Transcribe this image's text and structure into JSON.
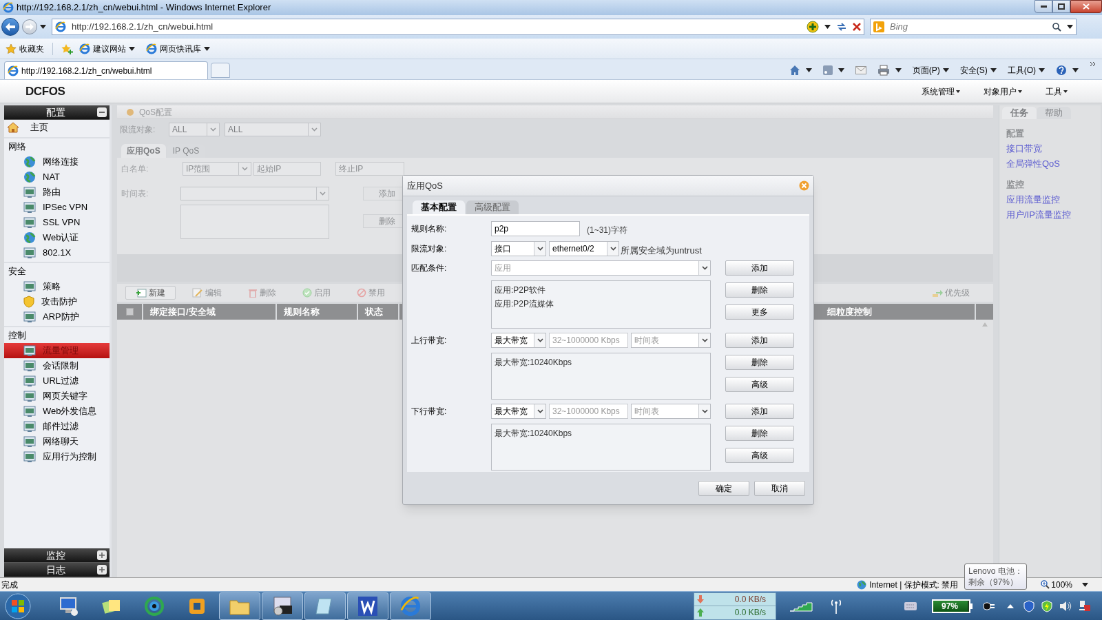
{
  "browser": {
    "title": "http://192.168.2.1/zh_cn/webui.html - Windows Internet Explorer",
    "address": "http://192.168.2.1/zh_cn/webui.html",
    "search_placeholder": "Bing",
    "favorites": [
      "收藏夹",
      "建议网站",
      "网页快讯库"
    ],
    "tab": "http://192.168.2.1/zh_cn/webui.html",
    "commands": [
      "页面(P)",
      "安全(S)",
      "工具(O)"
    ]
  },
  "app": {
    "logo": "DCFOS",
    "menus": [
      "系统管理",
      "对象用户",
      "工具"
    ]
  },
  "sidebar": {
    "panels": [
      {
        "title": "配置",
        "expanded": true,
        "sections": [
          {
            "items": [
              {
                "label": "主页",
                "selected": false
              }
            ]
          },
          {
            "heading": "网络",
            "items": [
              {
                "label": "网络连接",
                "selected": false
              },
              {
                "label": "NAT",
                "selected": false
              },
              {
                "label": "路由",
                "selected": false
              },
              {
                "label": "IPSec VPN",
                "selected": false
              },
              {
                "label": "SSL VPN",
                "selected": false
              },
              {
                "label": "Web认证",
                "selected": false
              },
              {
                "label": "802.1X",
                "selected": false
              }
            ]
          },
          {
            "heading": "安全",
            "items": [
              {
                "label": "策略",
                "selected": false
              },
              {
                "label": "攻击防护",
                "selected": false
              },
              {
                "label": "ARP防护",
                "selected": false
              }
            ]
          },
          {
            "heading": "控制",
            "items": [
              {
                "label": "流量管理",
                "selected": true
              },
              {
                "label": "会话限制",
                "selected": false
              },
              {
                "label": "URL过滤",
                "selected": false
              },
              {
                "label": "网页关键字",
                "selected": false
              },
              {
                "label": "Web外发信息",
                "selected": false
              },
              {
                "label": "邮件过滤",
                "selected": false
              },
              {
                "label": "网络聊天",
                "selected": false
              },
              {
                "label": "应用行为控制",
                "selected": false
              }
            ]
          }
        ]
      },
      {
        "title": "监控",
        "expanded": false
      },
      {
        "title": "日志",
        "expanded": false
      }
    ]
  },
  "qos_page": {
    "title": "QoS配置",
    "target_label": "限流对象:",
    "targets": [
      "ALL",
      "ALL"
    ],
    "tabs": [
      {
        "label": "应用QoS",
        "selected": true
      },
      {
        "label": "IP QoS",
        "selected": false
      }
    ],
    "whitelist_label": "白名单:",
    "whitelist_type": "IP范围",
    "start_ip_placeholder": "起始IP",
    "end_ip_placeholder": "终止IP",
    "schedule_label": "时间表:",
    "buttons": [
      "添加",
      "删除"
    ],
    "toolbar": [
      {
        "label": "新建",
        "disabled": false
      },
      {
        "label": "编辑",
        "disabled": true
      },
      {
        "label": "删除",
        "disabled": true
      },
      {
        "label": "启用",
        "disabled": true
      },
      {
        "label": "禁用",
        "disabled": true
      }
    ],
    "priority": {
      "label": "优先级",
      "disabled": true
    },
    "select_all": {
      "checked": false
    },
    "columns": [
      "绑定接口/安全域",
      "规则名称",
      "状态",
      "细粒度控制"
    ]
  },
  "dialog": {
    "title": "应用QoS",
    "tabs": [
      {
        "label": "基本配置",
        "selected": true
      },
      {
        "label": "高级配置",
        "selected": false
      }
    ],
    "rule_name": {
      "label": "规则名称:",
      "value": "p2p",
      "hint": "(1~31)字符"
    },
    "target": {
      "label": "限流对象:",
      "type": "接口",
      "interface": "ethernet0/2",
      "note": "所属安全域为untrust"
    },
    "match": {
      "label": "匹配条件:",
      "placeholder": "应用",
      "entries": [
        "应用:P2P软件",
        "应用:P2P流媒体"
      ],
      "buttons": [
        "添加",
        "删除",
        "更多"
      ]
    },
    "upstream": {
      "label": "上行带宽:",
      "type": "最大带宽",
      "bandwidth_placeholder": "32~1000000 Kbps",
      "schedule_placeholder": "时间表",
      "entries": [
        "最大带宽:10240Kbps"
      ],
      "buttons": [
        "添加",
        "删除",
        "高级"
      ]
    },
    "downstream": {
      "label": "下行带宽:",
      "type": "最大带宽",
      "bandwidth_placeholder": "32~1000000 Kbps",
      "schedule_placeholder": "时间表",
      "entries": [
        "最大带宽:10240Kbps"
      ],
      "buttons": [
        "添加",
        "删除",
        "高级"
      ]
    },
    "footer_buttons": [
      "确定",
      "取消"
    ]
  },
  "right_panel": {
    "tabs": [
      {
        "label": "任务",
        "selected": true
      },
      {
        "label": "帮助",
        "selected": false
      }
    ],
    "sections": [
      {
        "heading": "配置",
        "links": [
          "接口带宽",
          "全局弹性QoS"
        ]
      },
      {
        "heading": "监控",
        "links": [
          "应用流量监控",
          "用户/IP流量监控"
        ]
      }
    ]
  },
  "status_bar": {
    "text": "完成",
    "zone": "Internet | 保护模式: 禁用",
    "zoom": "100%"
  },
  "tooltip": {
    "lines": [
      "Lenovo 电池：",
      "剩余（97%）"
    ]
  },
  "taskbar": {
    "download": "0.0 KB/s",
    "upload": "0.0 KB/s",
    "battery": {
      "reading": "97%",
      "level": 0.97
    }
  }
}
